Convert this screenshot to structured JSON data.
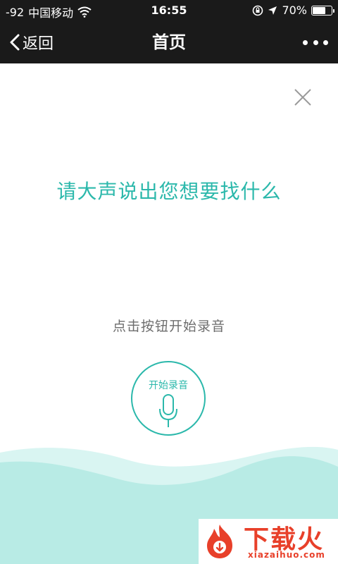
{
  "status_bar": {
    "signal": "-92",
    "carrier": "中国移动",
    "time": "16:55",
    "battery": "70%",
    "battery_level": 0.7,
    "icons": [
      "wifi-icon",
      "rotation-lock-icon",
      "location-arrow-icon",
      "battery-icon"
    ]
  },
  "nav": {
    "back_label": "返回",
    "title": "首页",
    "more_icon": "more-dots-icon"
  },
  "content": {
    "prompt": "请大声说出您想要找什么",
    "hint": "点击按钮开始录音",
    "record_label": "开始录音",
    "close_icon": "close-icon",
    "mic_icon": "microphone-icon"
  },
  "watermark": {
    "brand": "下载火",
    "domain": "xiazaihuo.com"
  },
  "colors": {
    "accent": "#2bb8ab",
    "bar_bg": "#1a1a1a",
    "wave_light": "#d9f5f2",
    "wave_main": "#b8ebe5",
    "watermark": "#e8402a"
  }
}
